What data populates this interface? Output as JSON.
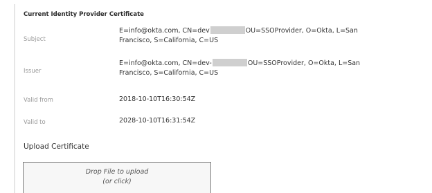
{
  "certificate": {
    "section_title": "Current Identity Provider Certificate",
    "rows": [
      {
        "label": "Subject",
        "value_line1_before_redaction": "E=info@okta.com, CN=dev",
        "value_line1_after_redaction": "OU=SSOProvider, O=Okta, L=San",
        "value_line2": "Francisco, S=California, C=US"
      },
      {
        "label": "Issuer",
        "value_line1_before_redaction": "E=info@okta.com, CN=dev-",
        "value_line1_after_redaction": "OU=SSOProvider, O=Okta, L=San",
        "value_line2": "Francisco, S=California, C=US"
      },
      {
        "label": "Valid from",
        "value": "2018-10-10T16:30:54Z"
      },
      {
        "label": "Valid to",
        "value": "2028-10-10T16:31:54Z"
      }
    ]
  },
  "upload": {
    "title": "Upload Certificate",
    "drop_line1": "Drop File to upload",
    "drop_line2": "(or click)"
  }
}
